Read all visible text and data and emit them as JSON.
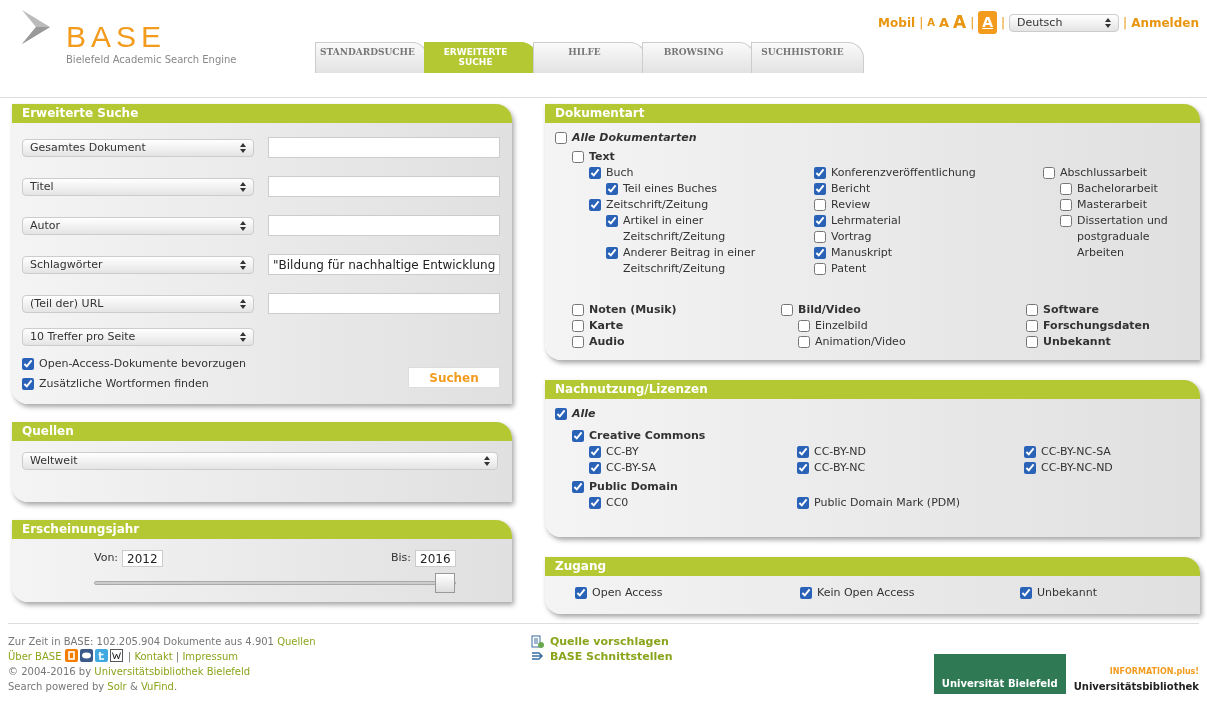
{
  "header": {
    "logo": {
      "title": "BASE",
      "subtitle": "Bielefeld Academic Search Engine"
    },
    "top_links": [
      {
        "kind": "link",
        "text": "Mobil"
      },
      {
        "kind": "sep",
        "text": "|"
      },
      {
        "kind": "fontsmall",
        "text": "A"
      },
      {
        "kind": "fontmedium",
        "text": "A"
      },
      {
        "kind": "fontlarge",
        "text": "A"
      },
      {
        "kind": "sep",
        "text": "|"
      },
      {
        "kind": "contrast",
        "text": "A"
      },
      {
        "kind": "sep",
        "text": "|"
      },
      {
        "kind": "select",
        "text": "Deutsch"
      },
      {
        "kind": "sep",
        "text": "|"
      },
      {
        "kind": "link",
        "text": "Anmelden"
      }
    ],
    "tabs": [
      {
        "label": "STANDARDSUCHE",
        "selected": false
      },
      {
        "label": "ERWEITERTE SUCHE",
        "selected": true
      },
      {
        "label": "HILFE",
        "selected": false
      },
      {
        "label": "BROWSING",
        "selected": false
      },
      {
        "label": "SUCHHISTORIE",
        "selected": false
      }
    ]
  },
  "search": {
    "title": "Erweiterte Suche",
    "rows": [
      {
        "field": "Gesamtes Dokument",
        "value": ""
      },
      {
        "field": "Titel",
        "value": ""
      },
      {
        "field": "Autor",
        "value": ""
      },
      {
        "field": "Schlagwörter",
        "value": "\"Bildung für nachhaltige Entwicklung"
      },
      {
        "field": "(Teil der) URL",
        "value": ""
      }
    ],
    "per_page": "10 Treffer pro Seite",
    "options": [
      {
        "label": "Open-Access-Dokumente bevorzugen",
        "checked": true
      },
      {
        "label": "Zusätzliche Wortformen finden",
        "checked": true
      }
    ],
    "button": "Suchen"
  },
  "sources": {
    "title": "Quellen",
    "select": "Weltweit"
  },
  "years": {
    "title": "Erscheinungsjahr",
    "from_label": "Von:",
    "from": "2012",
    "to_label": "Bis:",
    "to": "2016",
    "level": 1
  },
  "doc_types": {
    "title": "Dokumentart",
    "all": {
      "label": "Alle Dokumentarten",
      "checked": false
    },
    "text": {
      "label": "Text",
      "checked": false,
      "columns": [
        [
          {
            "label": "Buch",
            "checked": true,
            "children": [
              {
                "label": "Teil eines Buches",
                "checked": true
              }
            ]
          },
          {
            "label": "Zeitschrift/Zeitung",
            "checked": true,
            "children": [
              {
                "label": "Artikel in einer Zeitschrift/Zeitung",
                "checked": true
              },
              {
                "label": "Anderer Beitrag in einer Zeitschrift/Zeitung",
                "checked": true
              }
            ]
          }
        ],
        [
          {
            "label": "Konferenzveröffentlichung",
            "checked": true
          },
          {
            "label": "Bericht",
            "checked": true
          },
          {
            "label": "Review",
            "checked": false
          },
          {
            "label": "Lehrmaterial",
            "checked": true
          },
          {
            "label": "Vortrag",
            "checked": false
          },
          {
            "label": "Manuskript",
            "checked": true
          },
          {
            "label": "Patent",
            "checked": false
          }
        ],
        [
          {
            "label": "Abschlussarbeit",
            "checked": false,
            "children": [
              {
                "label": "Bachelorarbeit",
                "checked": false
              },
              {
                "label": "Masterarbeit",
                "checked": false
              },
              {
                "label": "Dissertation und postgraduale Arbeiten",
                "checked": false
              }
            ]
          }
        ]
      ]
    },
    "other_columns": [
      [
        {
          "label": "Noten (Musik)",
          "checked": false
        },
        {
          "label": "Karte",
          "checked": false
        },
        {
          "label": "Audio",
          "checked": false
        }
      ],
      [
        {
          "label": "Bild/Video",
          "checked": false,
          "children": [
            {
              "label": "Einzelbild",
              "checked": false
            },
            {
              "label": "Animation/Video",
              "checked": false
            }
          ]
        }
      ],
      [
        {
          "label": "Software",
          "checked": false
        },
        {
          "label": "Forschungsdaten",
          "checked": false
        },
        {
          "label": "Unbekannt",
          "checked": false
        }
      ]
    ]
  },
  "licenses": {
    "title": "Nachnutzung/Lizenzen",
    "all": {
      "label": "Alle",
      "checked": true
    },
    "groups": [
      {
        "label": "Creative Commons",
        "checked": true,
        "items": [
          {
            "label": "CC-BY",
            "checked": true
          },
          {
            "label": "CC-BY-ND",
            "checked": true
          },
          {
            "label": "CC-BY-NC-SA",
            "checked": true
          },
          {
            "label": "CC-BY-SA",
            "checked": true
          },
          {
            "label": "CC-BY-NC",
            "checked": true
          },
          {
            "label": "CC-BY-NC-ND",
            "checked": true
          }
        ]
      },
      {
        "label": "Public Domain",
        "checked": true,
        "items": [
          {
            "label": "CC0",
            "checked": true
          },
          {
            "label": "Public Domain Mark (PDM)",
            "checked": true
          }
        ]
      }
    ]
  },
  "access": {
    "title": "Zugang",
    "items": [
      {
        "label": "Open Access",
        "checked": true
      },
      {
        "label": "Kein Open Access",
        "checked": true
      },
      {
        "label": "Unbekannt",
        "checked": true
      }
    ]
  },
  "footer": {
    "lines": [
      [
        {
          "kind": "text",
          "text": "Zur Zeit in BASE: 102.205.904 Dokumente aus 4.901 "
        },
        {
          "kind": "link",
          "text": "Quellen"
        }
      ],
      [
        {
          "kind": "link",
          "text": "Über BASE"
        },
        {
          "kind": "icons"
        },
        {
          "kind": "text",
          "text": " | "
        },
        {
          "kind": "link",
          "text": "Kontakt"
        },
        {
          "kind": "text",
          "text": " | "
        },
        {
          "kind": "link",
          "text": "Impressum"
        }
      ],
      [
        {
          "kind": "text",
          "text": "© 2004-2016 by "
        },
        {
          "kind": "link",
          "text": "Universitätsbibliothek Bielefeld"
        }
      ],
      [
        {
          "kind": "text",
          "text": "Search powered by "
        },
        {
          "kind": "link",
          "text": "Solr"
        },
        {
          "kind": "text",
          "text": " & "
        },
        {
          "kind": "link",
          "text": "VuFind"
        },
        {
          "kind": "text",
          "text": "."
        }
      ]
    ],
    "links": [
      "Quelle vorschlagen",
      "BASE Schnittstellen"
    ],
    "logos": {
      "university": "Universität Bielefeld",
      "tagline": "INFORMATION.plus!",
      "library": "Universitätsbibliothek"
    }
  }
}
